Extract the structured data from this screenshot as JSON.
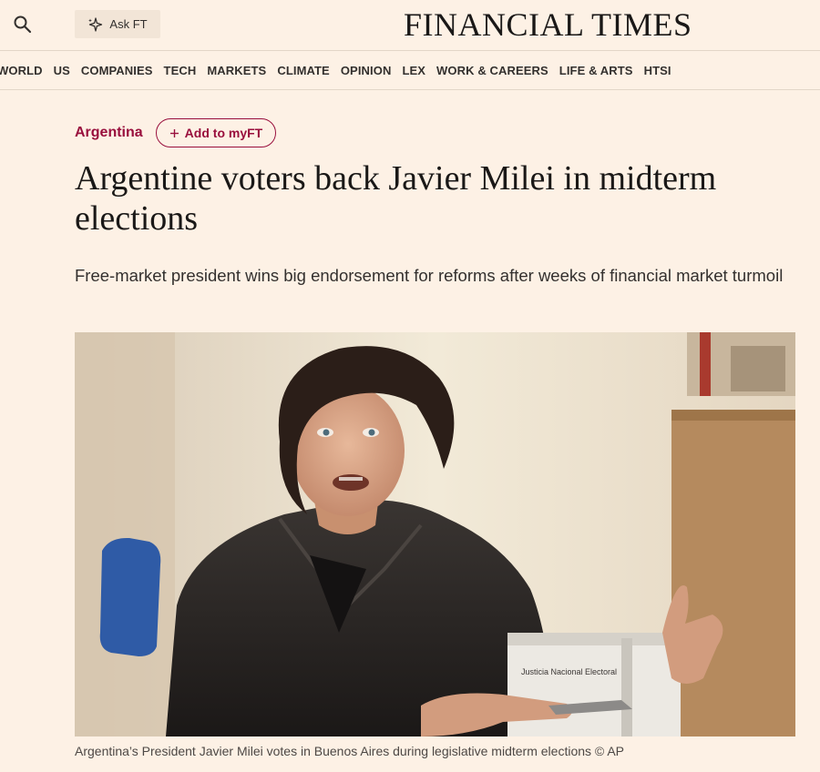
{
  "header": {
    "search_icon": "search-icon",
    "ask_label": "Ask FT",
    "ask_icon": "sparkle-icon",
    "masthead": "FINANCIAL TIMES"
  },
  "nav": {
    "items": [
      {
        "label": "WORLD"
      },
      {
        "label": "US"
      },
      {
        "label": "COMPANIES"
      },
      {
        "label": "TECH"
      },
      {
        "label": "MARKETS"
      },
      {
        "label": "CLIMATE"
      },
      {
        "label": "OPINION"
      },
      {
        "label": "LEX"
      },
      {
        "label": "WORK & CAREERS"
      },
      {
        "label": "LIFE & ARTS"
      },
      {
        "label": "HTSI"
      }
    ]
  },
  "article": {
    "topic": "Argentina",
    "add_myft": "Add to myFT",
    "add_icon": "plus-icon",
    "headline": "Argentine voters back Javier Milei in midterm elections",
    "standfirst": "Free-market president wins big endorsement for reforms after weeks of financial market turmoil",
    "image": {
      "ballot_box_label": "Justicia Nacional Electoral"
    },
    "caption": "Argentina’s President Javier Milei votes in Buenos Aires during legislative midterm elections © AP"
  },
  "colors": {
    "background": "#fdf1e5",
    "topic_claret": "#990f3d",
    "text": "#33302e"
  }
}
